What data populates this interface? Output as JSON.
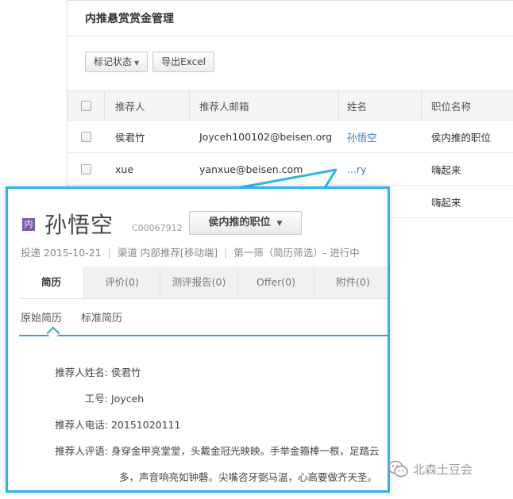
{
  "background": {
    "title": "内推悬赏赏金管理",
    "toolbar": {
      "mark_status_label": "标记状态",
      "export_label": "导出Excel"
    },
    "table": {
      "headers": [
        "推荐人",
        "推荐人邮箱",
        "姓名",
        "职位名称"
      ],
      "rows": [
        {
          "referrer": "侯君竹",
          "email": "Joyceh100102@beisen.org",
          "name": "孙悟空",
          "position": "侯内推的职位"
        },
        {
          "referrer": "xue",
          "email": "yanxue@beisen.com",
          "name": "...ry",
          "position": "嗨起来"
        },
        {
          "position": "嗨起来"
        }
      ]
    }
  },
  "popup": {
    "badge": "内",
    "candidate_name": "孙悟空",
    "candidate_id": "C00067912",
    "job_button_label": "侯内推的职位",
    "meta": {
      "applied": "投递 2015-10-21",
      "channel": "渠道 内部推荐[移动端]",
      "stage": "第一筛（简历筛选）- 进行中"
    },
    "tabs": [
      "简历",
      "评价(0)",
      "测评报告(0)",
      "Offer(0)",
      "附件(0)"
    ],
    "subtabs": [
      "原始简历",
      "标准简历"
    ],
    "fields": [
      {
        "label": "推荐人姓名:",
        "value": "侯君竹"
      },
      {
        "label": "工号:",
        "value": "Joyceh"
      },
      {
        "label": "推荐人电话:",
        "value": "20151020111"
      },
      {
        "label": "推荐人评语:",
        "value": "身穿金甲亮堂堂，头戴金冠光映映。手举金箍棒一根，足踏云"
      }
    ],
    "comment_continued": "多，声音响亮如钟磬。尖嘴咨牙弼马温，心高要做齐天圣。"
  },
  "watermark": {
    "text": "北森土豆会"
  },
  "colors": {
    "callout_border": "#2fb4e9",
    "link": "#3a7bd5",
    "badge": "#7b5aa6"
  }
}
